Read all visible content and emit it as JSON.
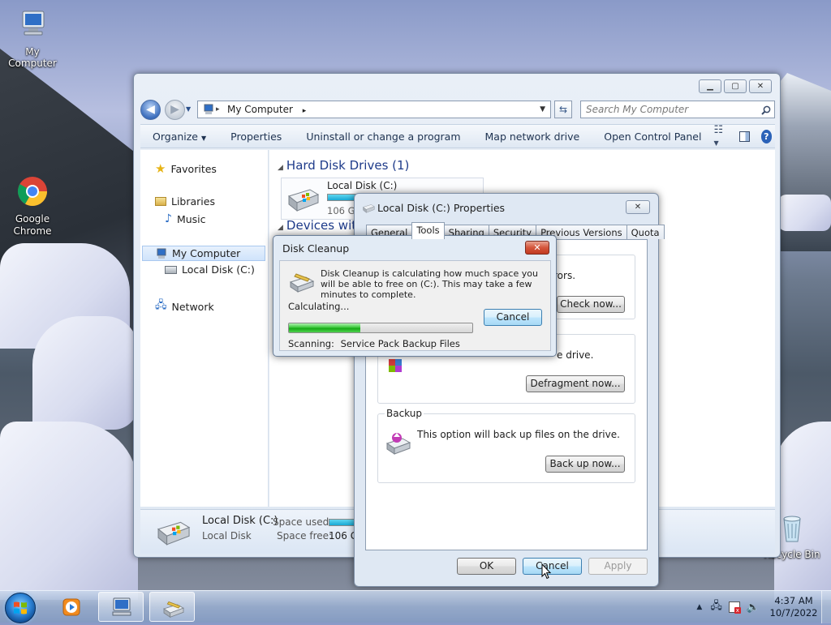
{
  "desktop": {
    "icons": [
      {
        "label": "My Computer"
      },
      {
        "label": "Google Chrome"
      },
      {
        "label": "Recycle Bin"
      }
    ]
  },
  "explorer": {
    "address": "My Computer",
    "search_placeholder": "Search My Computer",
    "toolbar": {
      "organize": "Organize",
      "properties": "Properties",
      "uninstall": "Uninstall or change a program",
      "map_drive": "Map network drive",
      "control_panel": "Open Control Panel"
    },
    "nav": {
      "favorites": "Favorites",
      "libraries": "Libraries",
      "music": "Music",
      "my_computer": "My Computer",
      "local_disk": "Local Disk (C:)",
      "network": "Network"
    },
    "content": {
      "hdd_group": "Hard Disk Drives (1)",
      "devices_group": "Devices with",
      "drive_name": "Local Disk (C:)",
      "drive_free": "106 GB",
      "drive_used_fraction": 0.2
    },
    "details": {
      "name": "Local Disk (C:)",
      "type": "Local Disk",
      "space_used_label": "Space used:",
      "space_free_label": "Space free:",
      "space_free_value": "106 GB"
    }
  },
  "properties": {
    "title": "Local Disk (C:) Properties",
    "tabs": [
      "General",
      "Tools",
      "Sharing",
      "Security",
      "Previous Versions",
      "Quota"
    ],
    "active_tab": "Tools",
    "error_check_text": "rors.",
    "check_now": "Check now...",
    "defrag_text": "e drive.",
    "defrag_now": "Defragment now...",
    "backup_title": "Backup",
    "backup_text": "This option will back up files on the drive.",
    "backup_now": "Back up now...",
    "ok": "OK",
    "cancel": "Cancel",
    "apply": "Apply"
  },
  "cleanup": {
    "title": "Disk Cleanup",
    "message": "Disk Cleanup is calculating how much space you will be able to free on  (C:). This may take a few minutes to complete.",
    "calculating": "Calculating...",
    "cancel": "Cancel",
    "progress": 0.39,
    "scanning_label": "Scanning:",
    "scanning_item": "Service Pack Backup Files"
  },
  "taskbar": {
    "time": "4:37 AM",
    "date": "10/7/2022"
  },
  "colors": {
    "link_blue": "#1e3b8a",
    "progress_green": "#16a916",
    "close_red": "#c13a22"
  }
}
